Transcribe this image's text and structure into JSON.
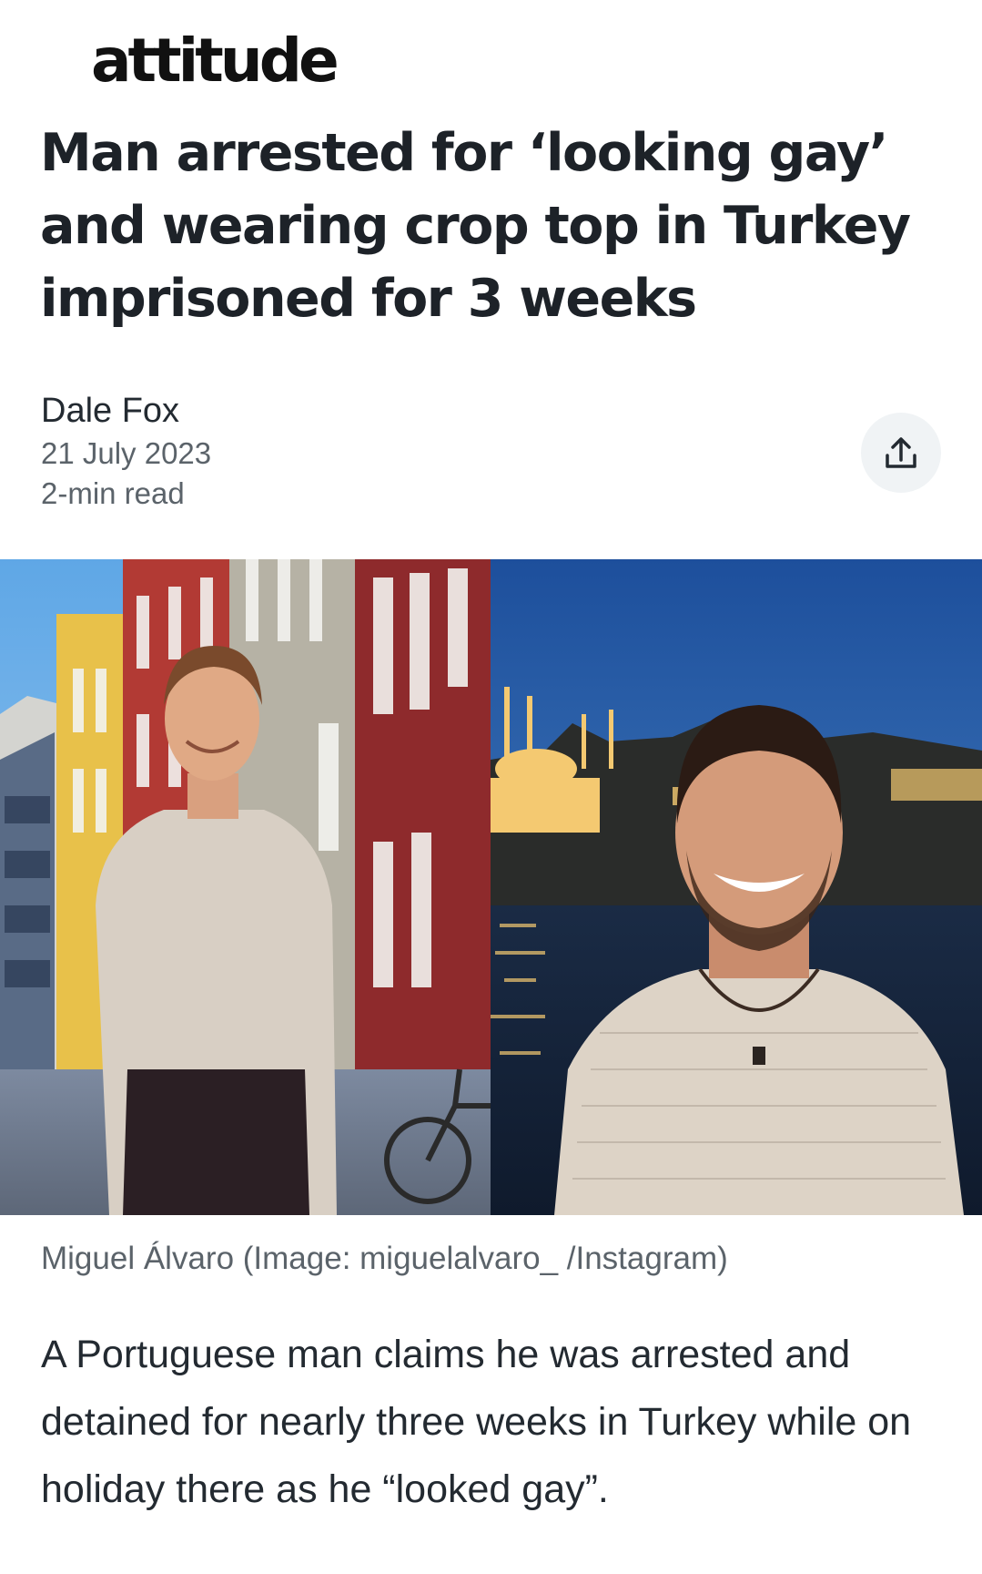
{
  "publisher": {
    "name": "attitude"
  },
  "article": {
    "headline": "Man arrested for ‘looking gay’ and wearing crop top in Turkey imprisoned for 3 weeks",
    "author": "Dale Fox",
    "date": "21 July 2023",
    "read_time": "2-min read",
    "share_icon": "share-upload-icon",
    "image_caption": "Miguel Álvaro (Image: miguelalvaro_ /Instagram)",
    "body": "A Portuguese man claims he was arrested and detained for nearly three weeks in Turkey while on holiday there as he “looked gay”."
  },
  "colors": {
    "headline": "#1d2228",
    "meta_gray": "#5b636a",
    "share_bg": "#f0f3f5"
  }
}
